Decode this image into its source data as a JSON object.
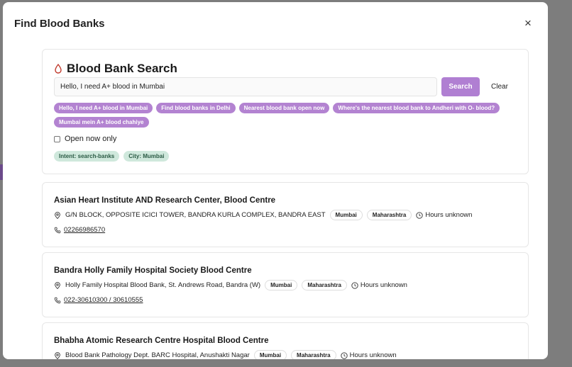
{
  "modal": {
    "title": "Find Blood Banks",
    "close_label": "×"
  },
  "search": {
    "title": "Blood Bank Search",
    "input_value": "Hello, I need A+ blood in Mumbai",
    "search_label": "Search",
    "clear_label": "Clear",
    "suggestions": [
      "Hello, I need A+ blood in Mumbai",
      "Find blood banks in Delhi",
      "Nearest blood bank open now",
      "Where's the nearest blood bank to Andheri with O- blood?",
      "Mumbai mein A+ blood chahiye"
    ],
    "open_now_label": "Open now only",
    "tags": [
      "Intent: search-banks",
      "City: Mumbai"
    ]
  },
  "results": [
    {
      "name": "Asian Heart Institute AND Research Center, Blood Centre",
      "address": "G/N BLOCK, OPPOSITE ICICI TOWER, BANDRA KURLA COMPLEX, BANDRA EAST",
      "city": "Mumbai",
      "state": "Maharashtra",
      "hours": "Hours unknown",
      "phone": "02266986570"
    },
    {
      "name": "Bandra Holly Family Hospital Society Blood Centre",
      "address": "Holly Family Hospital Blood Bank, St. Andrews Road, Bandra (W)",
      "city": "Mumbai",
      "state": "Maharashtra",
      "hours": "Hours unknown",
      "phone": "022-30610300 / 30610555"
    },
    {
      "name": "Bhabha Atomic Research Centre Hospital Blood Centre",
      "address": "Blood Bank Pathology Dept. BARC Hospital, Anushakti Nagar",
      "city": "Mumbai",
      "state": "Maharashtra",
      "hours": "Hours unknown",
      "phone": ""
    }
  ],
  "colors": {
    "accent": "#b07fd2",
    "chip": "#b383d1",
    "tag_bg": "#cfe8dc",
    "drop_icon": "#c0392b"
  },
  "icons": {
    "drop": "blood-drop-icon",
    "location": "map-pin-icon",
    "clock": "clock-icon",
    "phone": "phone-icon",
    "close": "close-icon"
  }
}
